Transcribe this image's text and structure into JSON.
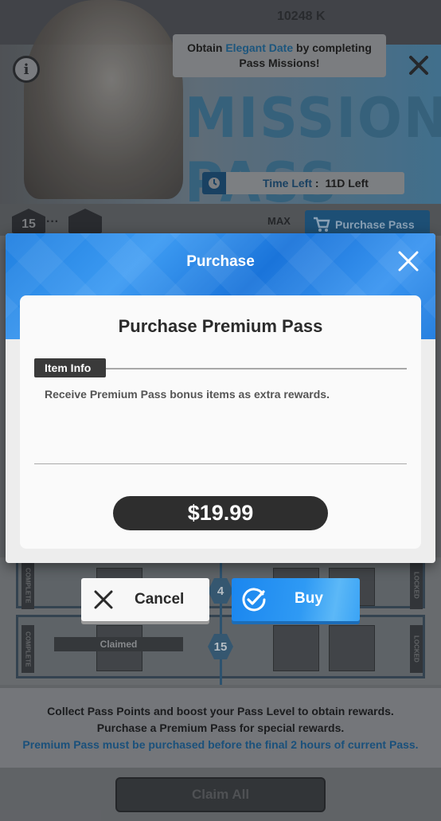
{
  "header": {
    "currency_value": "10248 K",
    "hint_prefix": "Obtain ",
    "hint_highlight": "Elegant Date",
    "hint_suffix": " by completing",
    "hint_line2": "Pass Missions!",
    "title": "MISSION PASS",
    "time_left_label": "Time Left",
    "time_left_sep": " : ",
    "time_left_value": "11D Left"
  },
  "level_row": {
    "current_level": "15",
    "ellipsis": "···",
    "max_label": "MAX",
    "purchase_pass_label": "Purchase Pass"
  },
  "reward_list": {
    "complete_tag": "COMPLETE",
    "locked_tag": "LOCKED",
    "claimed_label": "Claimed",
    "levels": [
      "4",
      "15"
    ]
  },
  "footer": {
    "line1": "Collect Pass Points and boost your Pass Level to obtain rewards.",
    "line2": "Purchase a Premium Pass for special rewards.",
    "line3": "Premium Pass must be purchased before the final 2 hours of current Pass.",
    "claim_all_label": "Claim All"
  },
  "modal": {
    "title": "Purchase",
    "card_title": "Purchase Premium Pass",
    "item_info_label": "Item Info",
    "description": "Receive Premium Pass bonus items as extra rewards.",
    "price": "$19.99"
  },
  "actions": {
    "cancel_label": "Cancel",
    "buy_label": "Buy"
  },
  "colors": {
    "accent_blue": "#1f7fe0",
    "dark_button": "#2e2e2e",
    "highlight_text": "#1e5c8d"
  }
}
